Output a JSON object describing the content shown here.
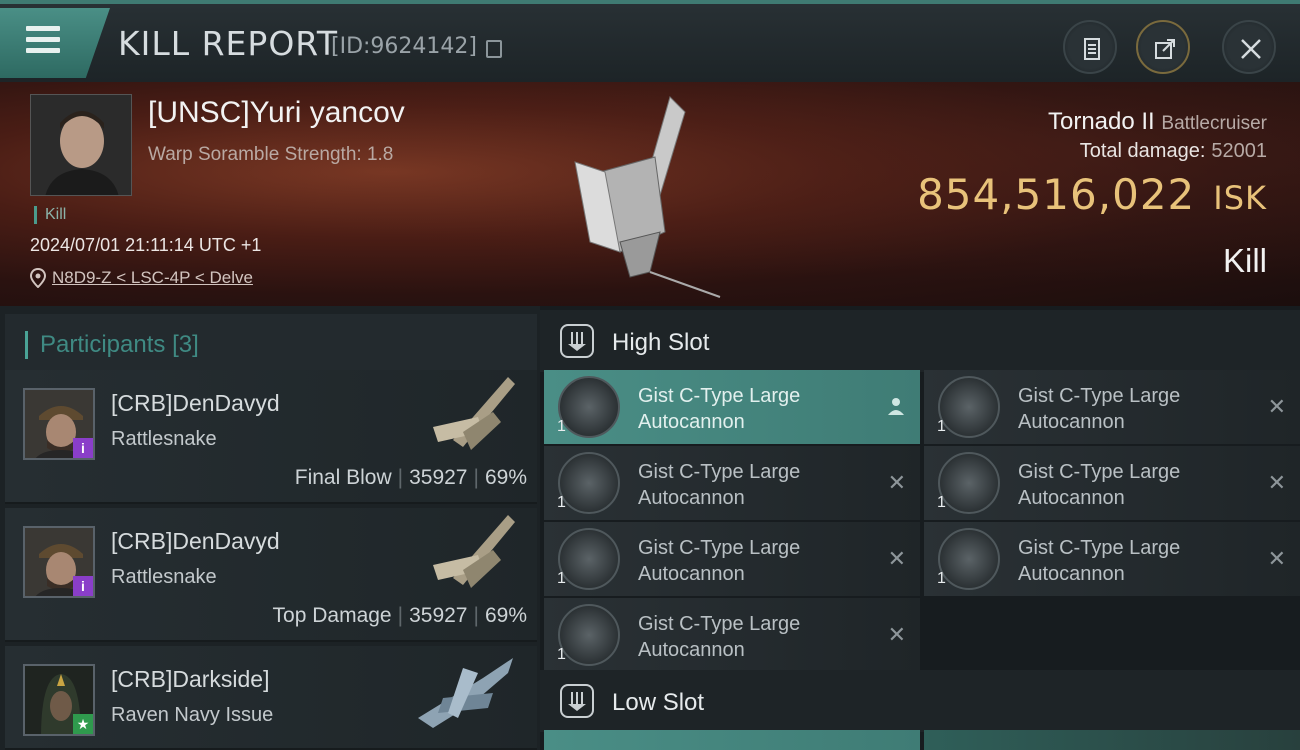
{
  "header": {
    "title": "KILL REPORT",
    "kill_id": "[ID:9624142]",
    "buttons": [
      "clipboard-icon",
      "share-icon",
      "close-icon"
    ]
  },
  "victim": {
    "name": "[UNSC]Yuri yancov",
    "scramble": "Warp Soramble Strength: 1.8",
    "tag": "Kill",
    "time": "2024/07/01 21:11:14 UTC +1",
    "location": "N8D9-Z < LSC-4P < Delve",
    "ship_name": "Tornado II",
    "ship_class": "Battlecruiser",
    "total_damage_label": "Total damage:",
    "total_damage": "52001",
    "isk_value": "854,516,022",
    "isk_unit": "ISK",
    "kill_label": "Kill"
  },
  "participants": {
    "title": "Participants",
    "count": "[3]",
    "rows": [
      {
        "name": "[CRB]DenDavyd",
        "ship": "Rattlesnake",
        "role": "Final Blow",
        "damage": "35927",
        "percent": "69%",
        "badge": "i"
      },
      {
        "name": "[CRB]DenDavyd",
        "ship": "Rattlesnake",
        "role": "Top Damage",
        "damage": "35927",
        "percent": "69%",
        "badge": "i"
      },
      {
        "name": "[CRB]Darkside]",
        "ship": "Raven Navy Issue",
        "badge": "★"
      }
    ]
  },
  "fittings": {
    "high_slot_label": "High Slot",
    "low_slot_label": "Low Slot",
    "modules": [
      {
        "line1": "Gist C-Type Large",
        "line2": "Autocannon",
        "qty": "1"
      },
      {
        "line1": "Gist C-Type Large",
        "line2": "Autocannon",
        "qty": "1"
      },
      {
        "line1": "Gist C-Type Large",
        "line2": "Autocannon",
        "qty": "1"
      },
      {
        "line1": "Gist C-Type Large",
        "line2": "Autocannon",
        "qty": "1"
      },
      {
        "line1": "Gist C-Type Large",
        "line2": "Autocannon",
        "qty": "1"
      },
      {
        "line1": "Gist C-Type Large",
        "line2": "Autocannon",
        "qty": "1"
      },
      {
        "line1": "Gist C-Type Large",
        "line2": "Autocannon",
        "qty": "1"
      }
    ]
  },
  "colors": {
    "accent": "#4a8f86",
    "isk": "#e8c27a",
    "badge_purple": "#8a3ec9",
    "badge_green": "#2f9a4d"
  }
}
